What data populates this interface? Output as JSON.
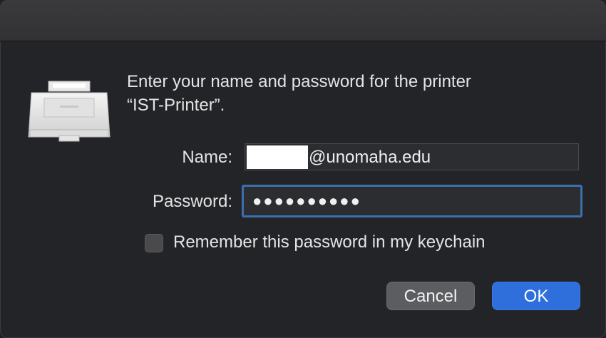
{
  "dialog": {
    "message_line1": "Enter your name and password for the printer",
    "message_line2": "“IST-Printer”.",
    "icon": "printer-icon"
  },
  "form": {
    "name_label": "Name:",
    "name_value": "@unomaha.edu",
    "password_label": "Password:",
    "password_value": "●●●●●●●●●●",
    "remember_label": "Remember this password in my keychain",
    "remember_checked": false
  },
  "buttons": {
    "cancel": "Cancel",
    "ok": "OK"
  },
  "colors": {
    "accent": "#2f6fdc",
    "focus_ring": "#3b6fae",
    "background": "#232427"
  }
}
